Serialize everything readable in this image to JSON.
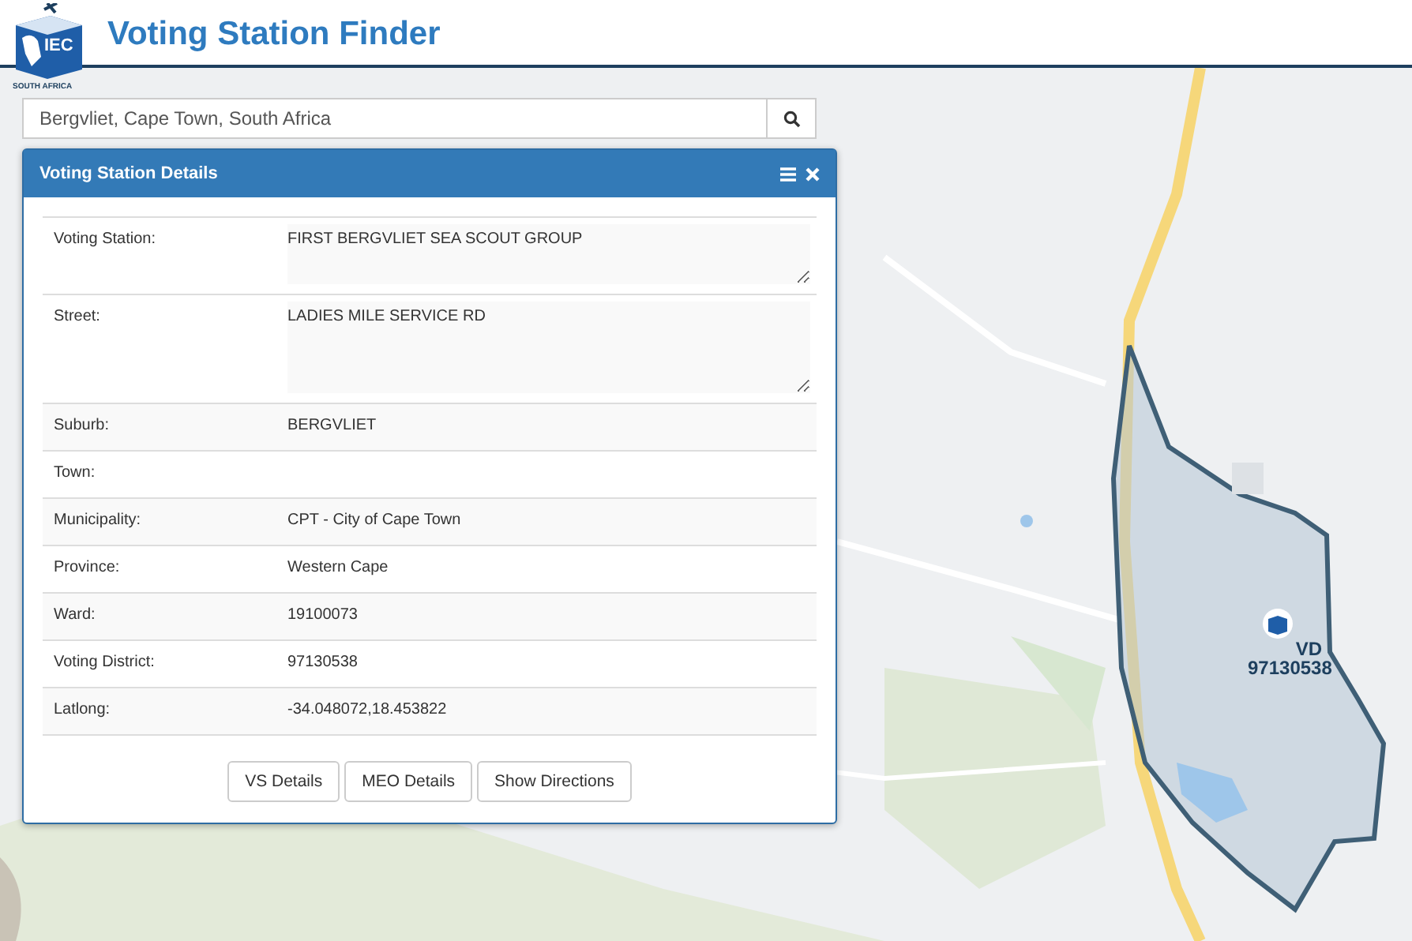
{
  "header": {
    "logo": {
      "mark": "IEC",
      "caption": "SOUTH AFRICA"
    },
    "title": "Voting Station Finder"
  },
  "search": {
    "value": "Bergvliet, Cape Town, South Africa"
  },
  "map": {
    "marker": {
      "label": "VD",
      "code": "97130538"
    }
  },
  "panel": {
    "title": "Voting Station Details",
    "rows": [
      {
        "label": "Voting Station:",
        "value": "FIRST BERGVLIET SEA SCOUT GROUP",
        "kind": "textarea"
      },
      {
        "label": "Street:",
        "value": "LADIES MILE SERVICE RD",
        "kind": "textarea"
      },
      {
        "label": "Suburb:",
        "value": "BERGVLIET",
        "kind": "text"
      },
      {
        "label": "Town:",
        "kind": "text"
      },
      {
        "label": "Municipality:",
        "value": "CPT - City of Cape Town",
        "kind": "text"
      },
      {
        "label": "Province:",
        "value": "Western Cape",
        "kind": "text"
      },
      {
        "label": "Ward:",
        "value": "19100073",
        "kind": "text"
      },
      {
        "label": "Voting District:",
        "value": "97130538",
        "kind": "text"
      },
      {
        "label": "Latlong:",
        "value": "-34.048072,18.453822",
        "kind": "text"
      }
    ],
    "buttons": [
      "VS Details",
      "MEO Details",
      "Show Directions"
    ]
  }
}
